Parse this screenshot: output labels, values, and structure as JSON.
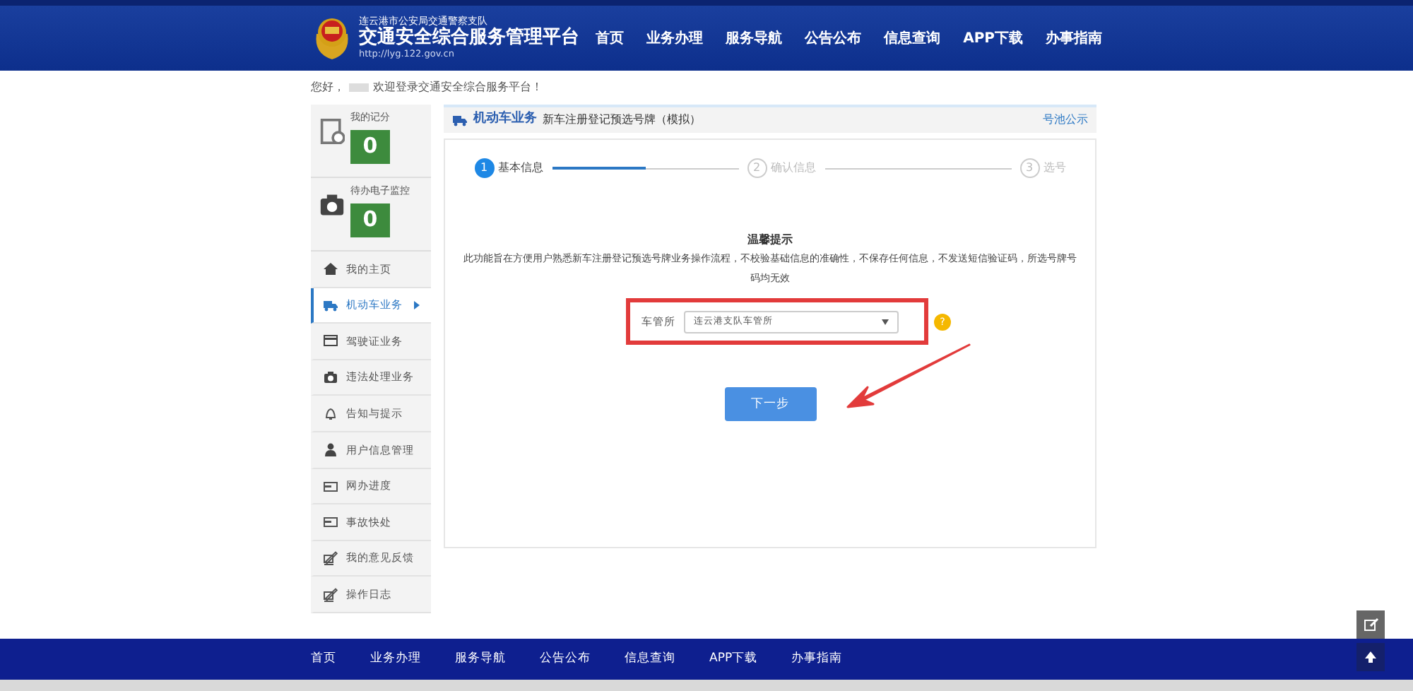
{
  "header": {
    "org": "连云港市公安局交通警察支队",
    "title": "交通安全综合服务管理平台",
    "url": "http://lyg.122.gov.cn",
    "nav": [
      {
        "label": "首页"
      },
      {
        "label": "业务办理"
      },
      {
        "label": "服务导航"
      },
      {
        "label": "公告公布"
      },
      {
        "label": "信息查询"
      },
      {
        "label": "APP下载"
      },
      {
        "label": "办事指南"
      }
    ]
  },
  "greeting": {
    "before": "您好，",
    "after": "欢迎登录交通安全综合服务平台！"
  },
  "sidebar": {
    "scores": [
      {
        "label": "我的记分",
        "value": "0",
        "kind": "doc"
      },
      {
        "label": "待办电子监控",
        "value": "0",
        "kind": "camera"
      }
    ],
    "items": [
      {
        "label": "我的主页",
        "kind": "home",
        "selected": false
      },
      {
        "label": "机动车业务",
        "kind": "truck",
        "selected": true
      },
      {
        "label": "驾驶证业务",
        "kind": "card",
        "selected": false
      },
      {
        "label": "违法处理业务",
        "kind": "camera",
        "selected": false
      },
      {
        "label": "告知与提示",
        "kind": "bell",
        "selected": false
      },
      {
        "label": "用户信息管理",
        "kind": "user",
        "selected": false
      },
      {
        "label": "网办进度",
        "kind": "tray",
        "selected": false
      },
      {
        "label": "事故快处",
        "kind": "tray",
        "selected": false
      },
      {
        "label": "我的意见反馈",
        "kind": "pen",
        "selected": false
      },
      {
        "label": "操作日志",
        "kind": "pen",
        "selected": false
      }
    ]
  },
  "breadcrumb": {
    "section": "机动车业务",
    "page": "新车注册登记预选号牌（模拟）",
    "link": "号池公示"
  },
  "steps": [
    {
      "number": "1",
      "label": "基本信息",
      "selected": true
    },
    {
      "number": "2",
      "label": "确认信息",
      "selected": false
    },
    {
      "number": "3",
      "label": "选号",
      "selected": false
    }
  ],
  "progress": {
    "level": 0.5
  },
  "notice": {
    "title": "温馨提示",
    "text": "此功能旨在方便用户熟悉新车注册登记预选号牌业务操作流程，不校验基础信息的准确性，不保存任何信息，不发送短信验证码，所选号牌号码均无效"
  },
  "form": {
    "label": "车管所",
    "value": "连云港支队车管所",
    "help": "?"
  },
  "next_button": "下一步",
  "footer": {
    "nav": [
      {
        "label": "首页"
      },
      {
        "label": "业务办理"
      },
      {
        "label": "服务导航"
      },
      {
        "label": "公告公布"
      },
      {
        "label": "信息查询"
      },
      {
        "label": "APP下载"
      },
      {
        "label": "办事指南"
      }
    ]
  }
}
